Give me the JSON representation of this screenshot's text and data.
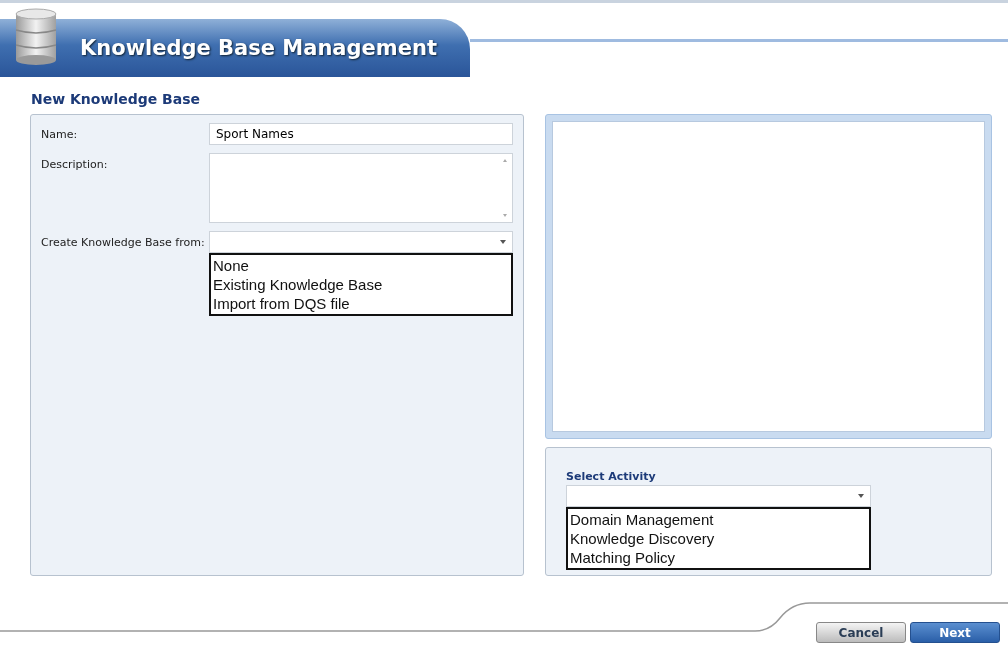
{
  "header": {
    "title": "Knowledge Base Management"
  },
  "section_title": "New Knowledge Base",
  "fields": [
    {
      "kind": "text",
      "label": "Name:",
      "value": "Sport Names"
    },
    {
      "kind": "textarea",
      "label": "Description:"
    },
    {
      "kind": "select",
      "label": "Create Knowledge Base from:",
      "options": [
        "None",
        "Existing Knowledge Base",
        "Import from DQS file"
      ]
    }
  ],
  "activity": {
    "label": "Select Activity",
    "options": [
      "Domain Management",
      "Knowledge Discovery",
      "Matching Policy"
    ]
  },
  "buttons": [
    {
      "label": "Cancel",
      "kind": "secondary"
    },
    {
      "label": "Next",
      "kind": "primary"
    }
  ]
}
